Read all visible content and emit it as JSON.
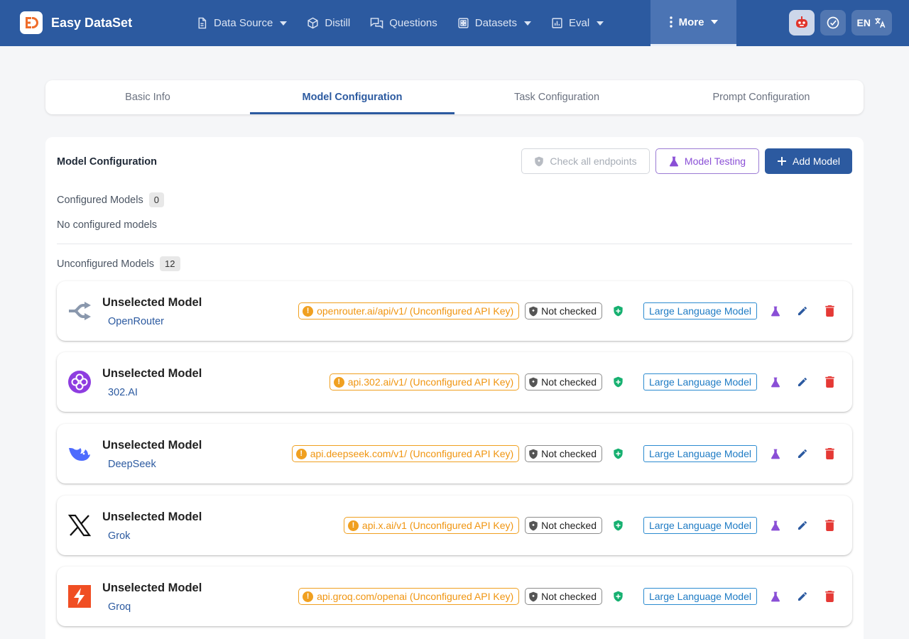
{
  "app": {
    "title": "Easy DataSet",
    "colors": {
      "primary": "#2c5aa0",
      "warning": "#f0a020",
      "success": "#16b070",
      "danger": "#e53935",
      "accent": "#8a4fd6"
    }
  },
  "nav": [
    {
      "label": "Data Source",
      "icon": "document-icon",
      "dropdown": true
    },
    {
      "label": "Distill",
      "icon": "cube-icon",
      "dropdown": false
    },
    {
      "label": "Questions",
      "icon": "chat-icon",
      "dropdown": false
    },
    {
      "label": "Datasets",
      "icon": "grid-icon",
      "dropdown": true
    },
    {
      "label": "Eval",
      "icon": "bar-chart-icon",
      "dropdown": true
    },
    {
      "label": "More",
      "icon": "more-vertical-icon",
      "dropdown": true,
      "active": true
    }
  ],
  "header_buttons": {
    "lang": "EN"
  },
  "tabs": [
    {
      "label": "Basic Info",
      "active": false
    },
    {
      "label": "Model Configuration",
      "active": true
    },
    {
      "label": "Task Configuration",
      "active": false
    },
    {
      "label": "Prompt Configuration",
      "active": false
    }
  ],
  "panel": {
    "title": "Model Configuration",
    "check_all": "Check all endpoints",
    "model_testing": "Model Testing",
    "add_model": "Add Model",
    "configured_label": "Configured Models",
    "configured_count": "0",
    "no_configured": "No configured models",
    "unconfigured_label": "Unconfigured Models",
    "unconfigured_count": "12"
  },
  "models": [
    {
      "name": "Unselected Model",
      "provider": "OpenRouter",
      "icon": "openrouter-logo-icon",
      "endpoint": "openrouter.ai/api/v1/ (Unconfigured API Key)",
      "status": "Not checked",
      "type": "Large Language Model"
    },
    {
      "name": "Unselected Model",
      "provider": "302.AI",
      "icon": "302ai-logo-icon",
      "endpoint": "api.302.ai/v1/ (Unconfigured API Key)",
      "status": "Not checked",
      "type": "Large Language Model"
    },
    {
      "name": "Unselected Model",
      "provider": "DeepSeek",
      "icon": "deepseek-whale-icon",
      "endpoint": "api.deepseek.com/v1/ (Unconfigured API Key)",
      "status": "Not checked",
      "type": "Large Language Model"
    },
    {
      "name": "Unselected Model",
      "provider": "Grok",
      "icon": "x-logo-icon",
      "endpoint": "api.x.ai/v1 (Unconfigured API Key)",
      "status": "Not checked",
      "type": "Large Language Model"
    },
    {
      "name": "Unselected Model",
      "provider": "Groq",
      "icon": "groq-bolt-icon",
      "endpoint": "api.groq.com/openai (Unconfigured API Key)",
      "status": "Not checked",
      "type": "Large Language Model"
    }
  ]
}
